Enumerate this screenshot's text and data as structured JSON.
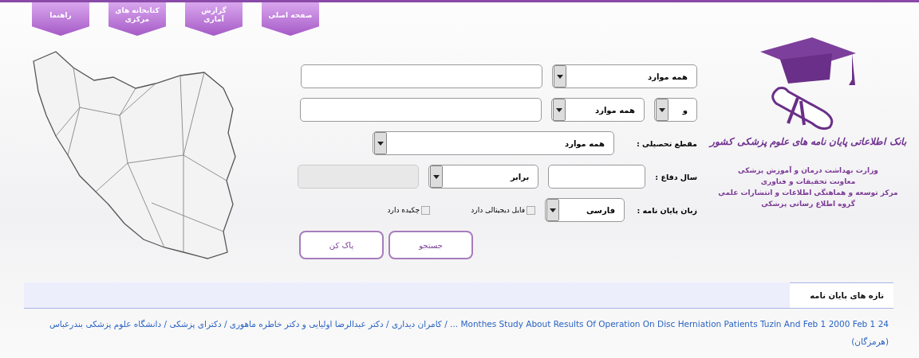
{
  "nav_tabs": [
    {
      "label": "صفحه اصلی"
    },
    {
      "label": "گزارش آماری"
    },
    {
      "label": "کتابخانه های مرکزی"
    },
    {
      "label": "راهنما"
    }
  ],
  "header": {
    "title": "بانک اطلاعاتی پایان نامه های علوم پزشکی کشور",
    "subtitle_lines": [
      "وزارت بهداشت درمان و آموزش پزشکی",
      "معاونت تحقیقات و فناوری",
      "مرکز توسعه و هماهنگی اطلاعات و انتشارات علمی",
      "گروه اطلاع رسانی پزشکی"
    ]
  },
  "search_form": {
    "rows": [
      {
        "fields": [
          {
            "kind": "select",
            "value": "همه موارد"
          },
          {
            "kind": "input",
            "disabled": false
          }
        ]
      },
      {
        "fields": [
          {
            "kind": "select",
            "value": "و"
          },
          {
            "kind": "select",
            "value": "همه موارد"
          },
          {
            "kind": "input",
            "disabled": false
          }
        ]
      },
      {
        "fields": [
          {
            "kind": "label",
            "text": "مقطع تحصیلی :"
          },
          {
            "kind": "select",
            "value": "همه موارد"
          }
        ]
      },
      {
        "fields": [
          {
            "kind": "label",
            "text": "سال دفاع :"
          },
          {
            "kind": "input",
            "disabled": false
          },
          {
            "kind": "select",
            "value": "برابر"
          },
          {
            "kind": "input",
            "disabled": true
          }
        ]
      },
      {
        "fields": [
          {
            "kind": "label",
            "text": "زبان پایان نامه :"
          },
          {
            "kind": "select",
            "value": "فارسی"
          },
          {
            "kind": "checkbox",
            "label": "فایل دیجیتالی دارد",
            "checked": false
          },
          {
            "kind": "checkbox",
            "label": "چکیده دارد",
            "checked": false
          }
        ]
      }
    ],
    "buttons": [
      {
        "label": "جستجو"
      },
      {
        "label": "پاک کن"
      }
    ]
  },
  "news": {
    "tab": "تازه های پایان نامه",
    "items": [
      {
        "text": "Monthes Study About Results Of Operation On Disc Herniation Patients Tuzin And Feb 1 2000 Feb 1 24 ... / کامران دیداری / دکتر عبدالرضا اولیایی و دکتر خاطره ماهوری / دکترای پزشکی / دانشگاه علوم پزشکی بندرعباس (هرمزگان)"
      }
    ]
  }
}
